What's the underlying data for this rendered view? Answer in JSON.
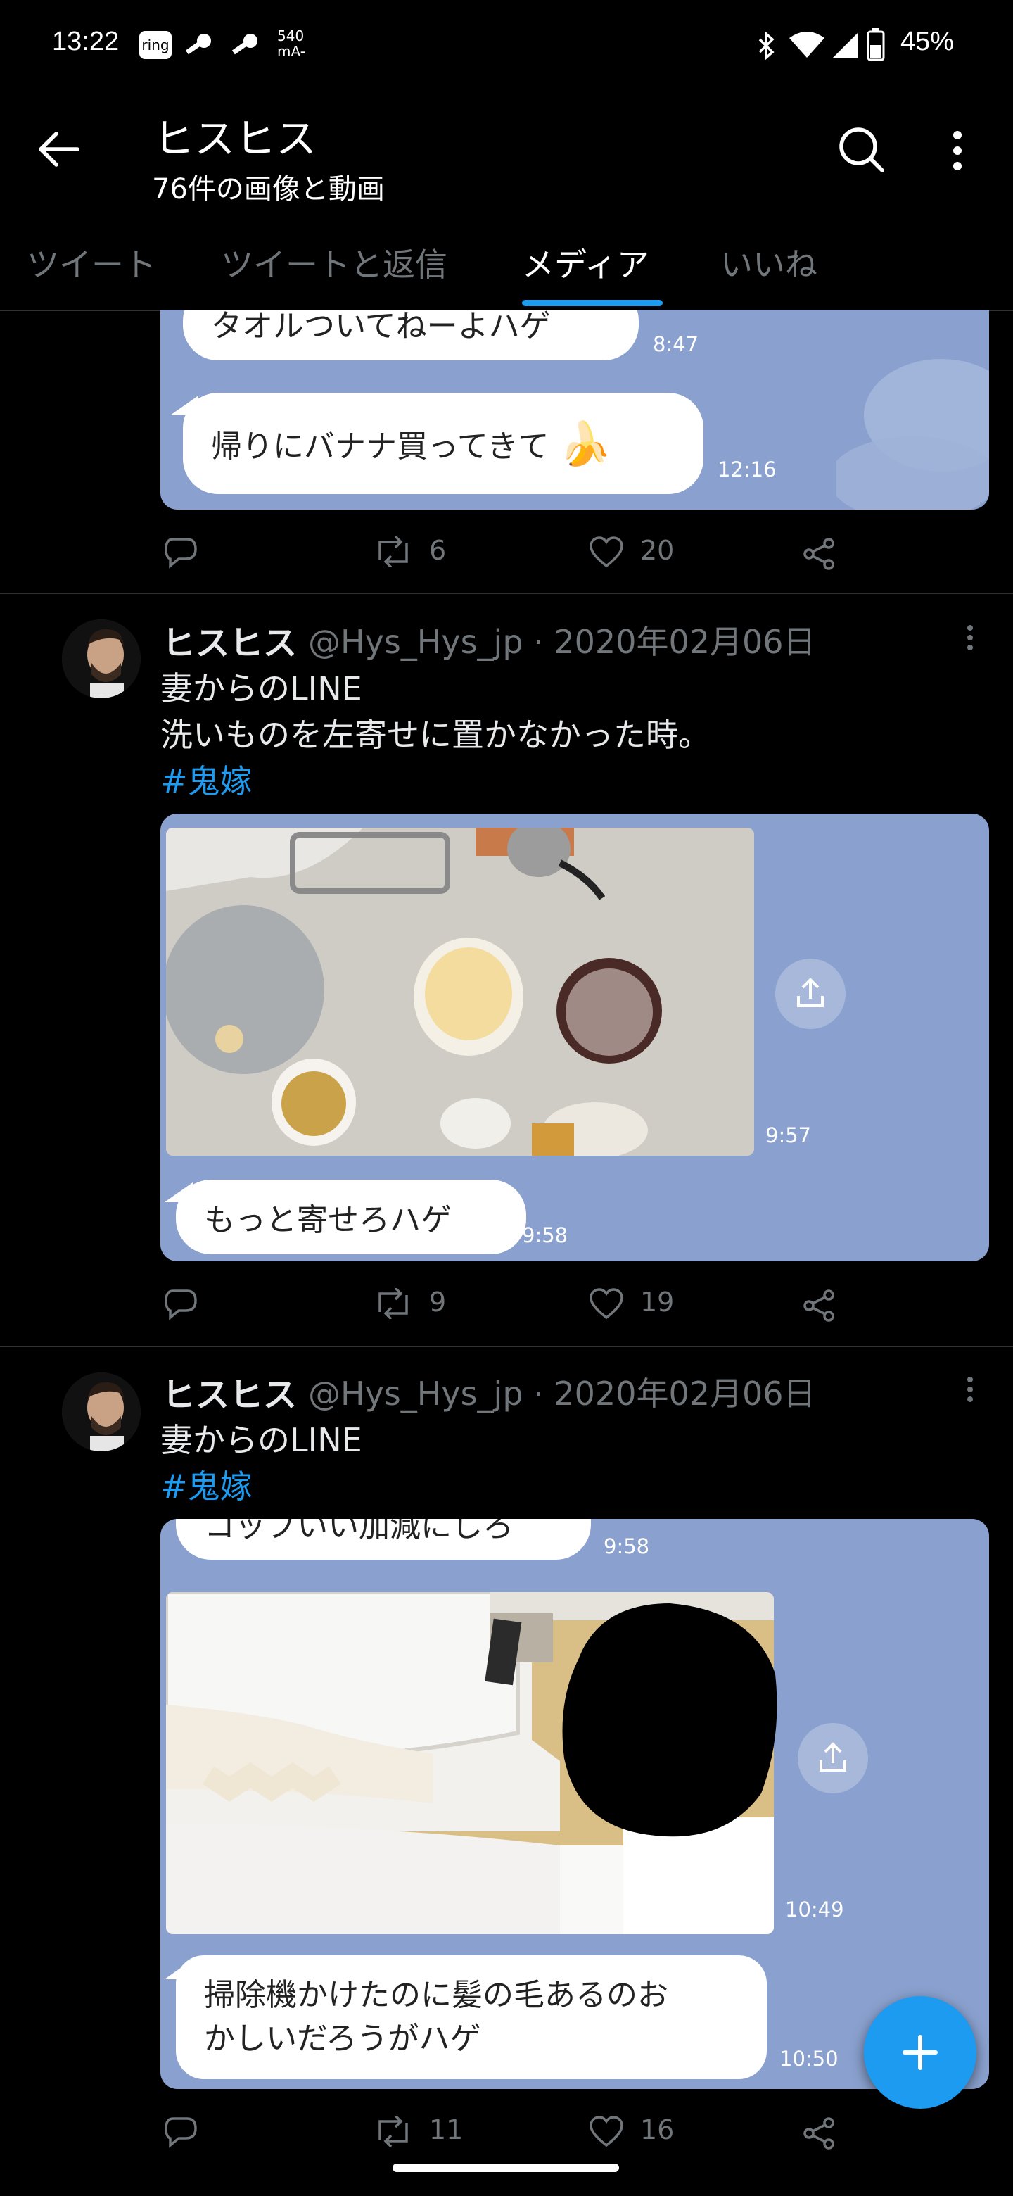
{
  "status_bar": {
    "time": "13:22",
    "icons_left": [
      "ring-icon",
      "key-icon",
      "key-icon",
      "mA-icon"
    ],
    "mA_text": "540 mA-",
    "battery": "45%"
  },
  "header": {
    "title": "ヒスヒス",
    "subtitle": "76件の画像と動画"
  },
  "tabs": [
    {
      "label": "ツイート",
      "active": false
    },
    {
      "label": "ツイートと返信",
      "active": false
    },
    {
      "label": "メディア",
      "active": true
    },
    {
      "label": "いいね",
      "active": false
    }
  ],
  "tweet0": {
    "chat": {
      "bubble1": "タオルついてねーよハゲ",
      "ts1": "8:47",
      "bubble2": "帰りにバナナ買ってきて",
      "ts2": "12:16"
    },
    "retweets": "6",
    "likes": "20"
  },
  "tweet1": {
    "name": "ヒスヒス",
    "handle": "@Hys_Hys_jp · 2020年02月06日",
    "line1": "妻からのLINE",
    "line2": "洗いものを左寄せに置かなかった時。",
    "hashtag": "#鬼嫁",
    "chat": {
      "photo_ts": "9:57",
      "bubble": "もっと寄せろハゲ",
      "ts": "9:58"
    },
    "retweets": "9",
    "likes": "19"
  },
  "tweet2": {
    "name": "ヒスヒス",
    "handle": "@Hys_Hys_jp · 2020年02月06日",
    "line1": "妻からのLINE",
    "hashtag": "#鬼嫁",
    "chat": {
      "bubble_top": "コップいい加減にしろ",
      "ts_top": "9:58",
      "photo_ts": "10:49",
      "bubble_line1": "掃除機かけたのに髪の毛あるのお",
      "bubble_line2": "かしいだろうがハゲ",
      "ts": "10:50"
    },
    "retweets": "11",
    "likes": "16"
  },
  "colors": {
    "accent": "#1d9bf0",
    "chat_bg": "#8aa1cf",
    "muted": "#71767b"
  }
}
